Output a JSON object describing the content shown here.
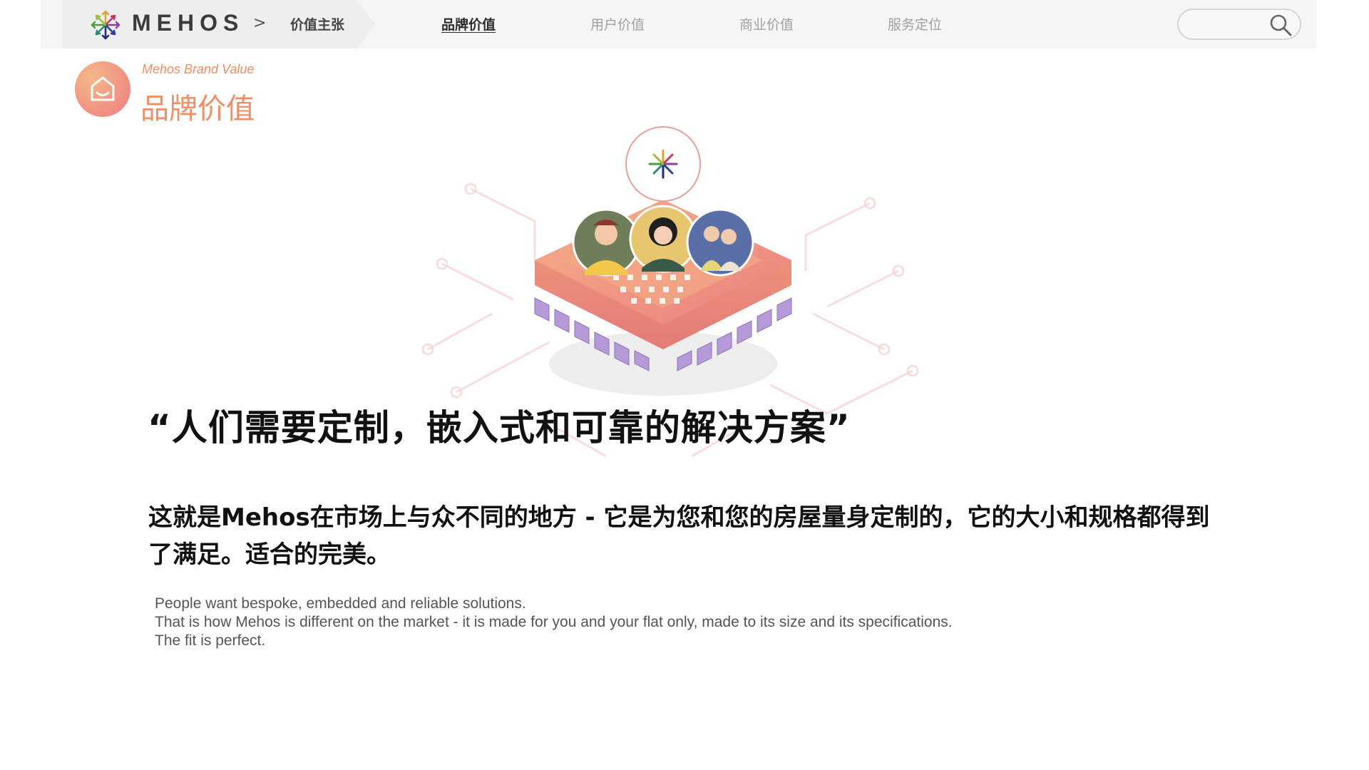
{
  "header": {
    "brand": "MEHOS",
    "breadcrumb_separator": ">",
    "breadcrumb_current": "价值主张",
    "tabs": [
      {
        "label": "品牌价值",
        "active": true
      },
      {
        "label": "用户价值",
        "active": false
      },
      {
        "label": "商业价值",
        "active": false
      },
      {
        "label": "服务定位",
        "active": false
      }
    ],
    "search": {
      "placeholder": ""
    }
  },
  "section": {
    "english_title": "Mehos Brand Value",
    "title": "品牌价值"
  },
  "content": {
    "quote": "“人们需要定制，嵌入式和可靠的解决方案”",
    "description": "这就是Mehos在市场上与众不同的地方 - 它是为您和您的房屋量身定制的，它的大小和规格都得到了满足。适合的完美。",
    "english_lines": [
      "People want bespoke, embedded and reliable solutions.",
      "That is how Mehos is different on the market - it is made for you and your flat only, made to its size and its specifications.",
      "The fit is perfect."
    ]
  },
  "icons": {
    "logo": "mehos-flower-logo",
    "search": "search-icon",
    "section": "home-icon",
    "illustration": "chip-with-people-illustration"
  },
  "colors": {
    "accent": "#ef8f67",
    "active_tab": "#2d2d2d",
    "inactive_tab": "#a0a0a0"
  }
}
